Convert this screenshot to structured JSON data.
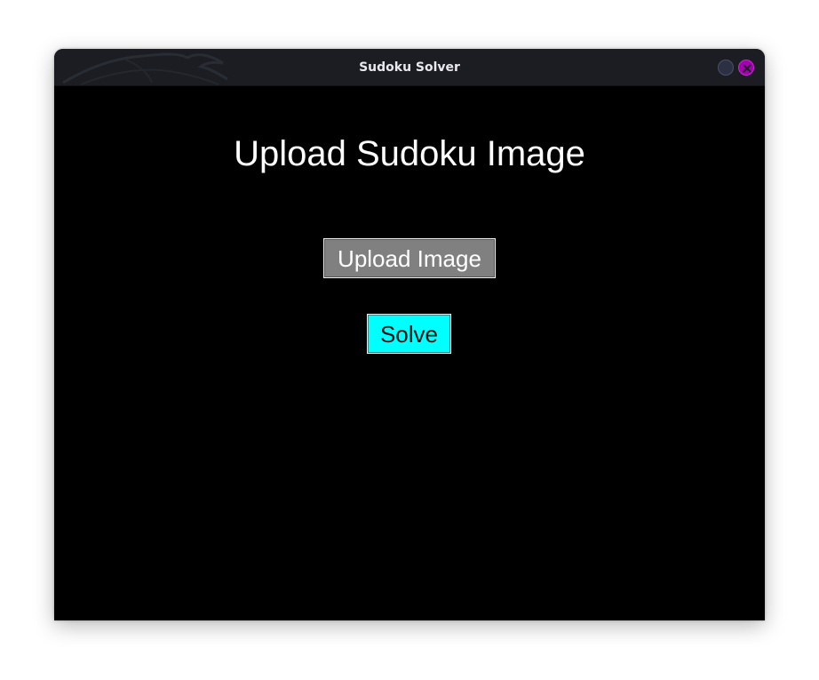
{
  "window": {
    "title": "Sudoku Solver",
    "controls": [
      {
        "name": "minimize",
        "icon": "circle-icon",
        "color": "#2c3042"
      },
      {
        "name": "close",
        "icon": "close-icon",
        "color": "#a400b0"
      }
    ]
  },
  "main": {
    "heading": "Upload Sudoku Image",
    "upload_label": "Upload Image",
    "solve_label": "Solve"
  },
  "colors": {
    "background": "#000000",
    "titlebar": "#1b1d23",
    "upload_button": "#808080",
    "solve_button": "#00ffff",
    "close_accent": "#a400b0"
  }
}
